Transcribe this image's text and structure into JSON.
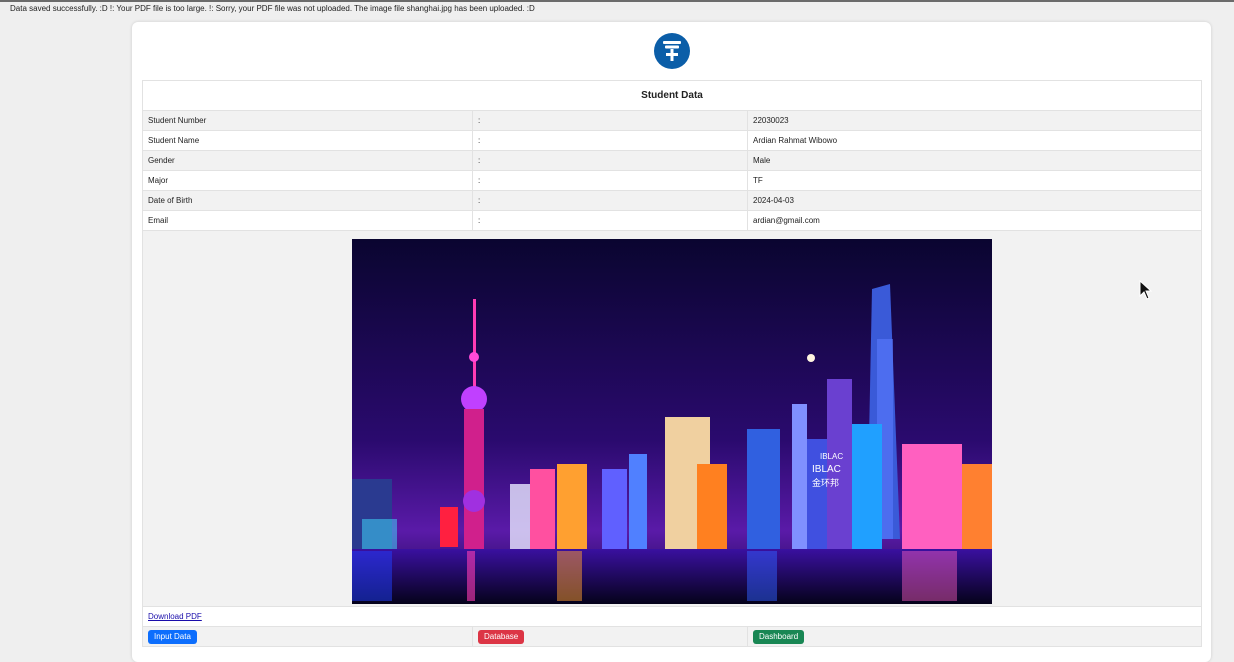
{
  "status_message": "Data saved successfully. :D !: Your PDF file is too large. !: Sorry, your PDF file was not uploaded. The image file shanghai.jpg has been uploaded. :D",
  "table": {
    "title": "Student Data",
    "separator": ":",
    "rows": [
      {
        "label": "Student Number",
        "value": "22030023"
      },
      {
        "label": "Student Name",
        "value": "Ardian Rahmat Wibowo"
      },
      {
        "label": "Gender",
        "value": "Male"
      },
      {
        "label": "Major",
        "value": "TF"
      },
      {
        "label": "Date of Birth",
        "value": "2024-04-03"
      },
      {
        "label": "Email",
        "value": "ardian@gmail.com"
      }
    ]
  },
  "photo": {
    "sign_top": "IBLAC",
    "sign_mid": "IBLAC",
    "sign_low": "金环邦"
  },
  "download_link": "Download PDF",
  "buttons": {
    "input": "Input Data",
    "database": "Database",
    "dashboard": "Dashboard"
  },
  "colors": {
    "logo": "#0b5ea8",
    "btn_blue": "#0d6efd",
    "btn_red": "#dc3545",
    "btn_green": "#198754"
  }
}
